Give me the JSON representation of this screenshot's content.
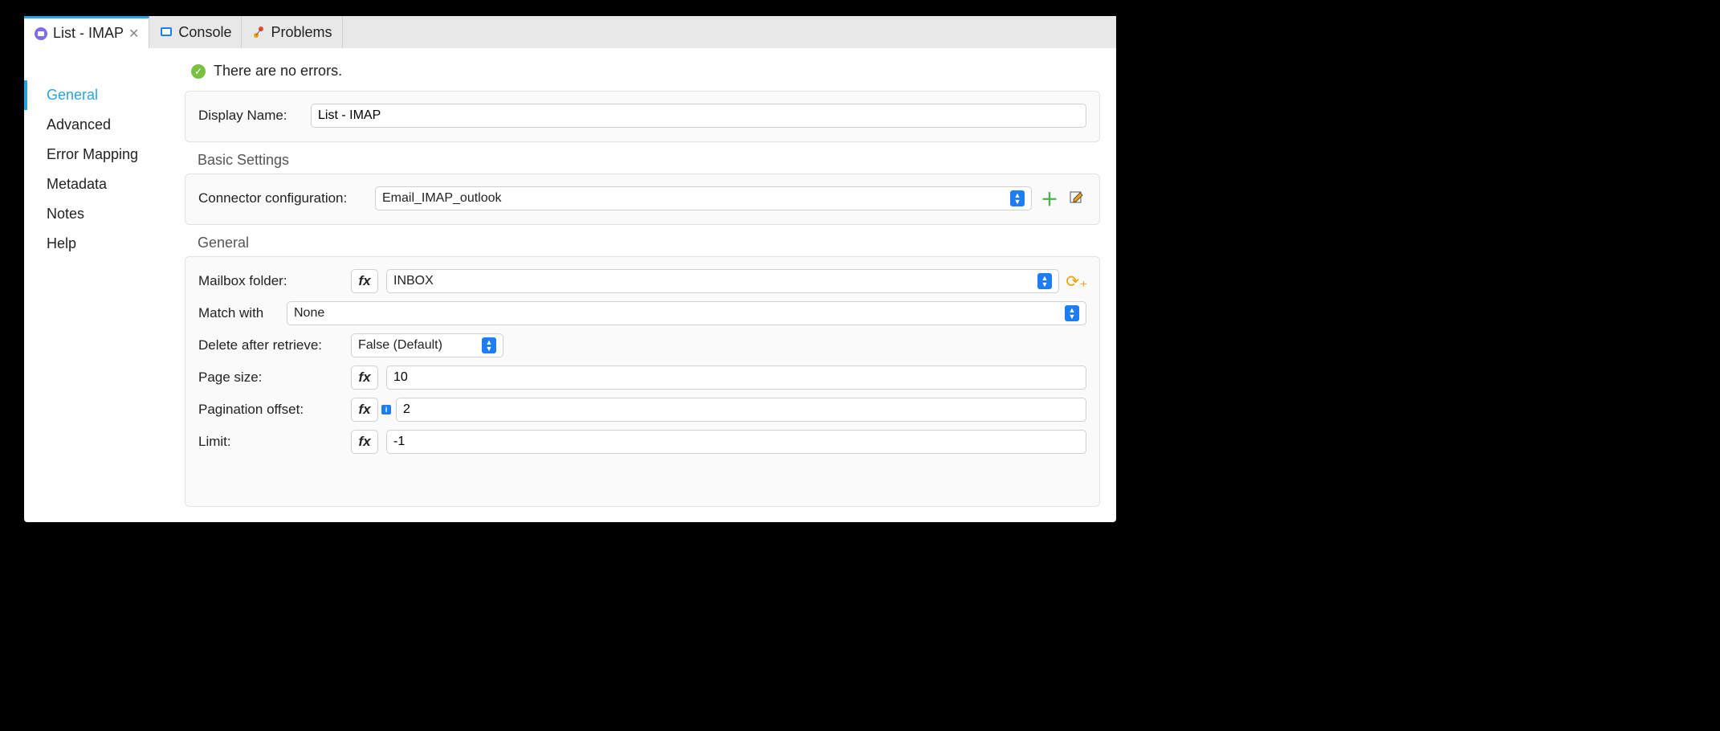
{
  "tabs": [
    {
      "label": "List - IMAP",
      "active": true,
      "closable": true,
      "icon": "imap"
    },
    {
      "label": "Console",
      "active": false,
      "closable": false,
      "icon": "console"
    },
    {
      "label": "Problems",
      "active": false,
      "closable": false,
      "icon": "problems"
    }
  ],
  "sidebar": {
    "items": [
      {
        "label": "General",
        "active": true
      },
      {
        "label": "Advanced",
        "active": false
      },
      {
        "label": "Error Mapping",
        "active": false
      },
      {
        "label": "Metadata",
        "active": false
      },
      {
        "label": "Notes",
        "active": false
      },
      {
        "label": "Help",
        "active": false
      }
    ]
  },
  "status": {
    "message": "There are no errors."
  },
  "display_name": {
    "label": "Display Name:",
    "value": "List - IMAP"
  },
  "basic_settings": {
    "title": "Basic Settings",
    "connector_label": "Connector configuration:",
    "connector_value": "Email_IMAP_outlook"
  },
  "general": {
    "title": "General",
    "mailbox_label": "Mailbox folder:",
    "mailbox_value": "INBOX",
    "match_label": "Match with",
    "match_value": "None",
    "delete_label": "Delete after retrieve:",
    "delete_value": "False (Default)",
    "page_size_label": "Page size:",
    "page_size_value": "10",
    "pagination_label": "Pagination offset:",
    "pagination_value": "2",
    "limit_label": "Limit:",
    "limit_value": "-1",
    "fx_label": "fx"
  }
}
